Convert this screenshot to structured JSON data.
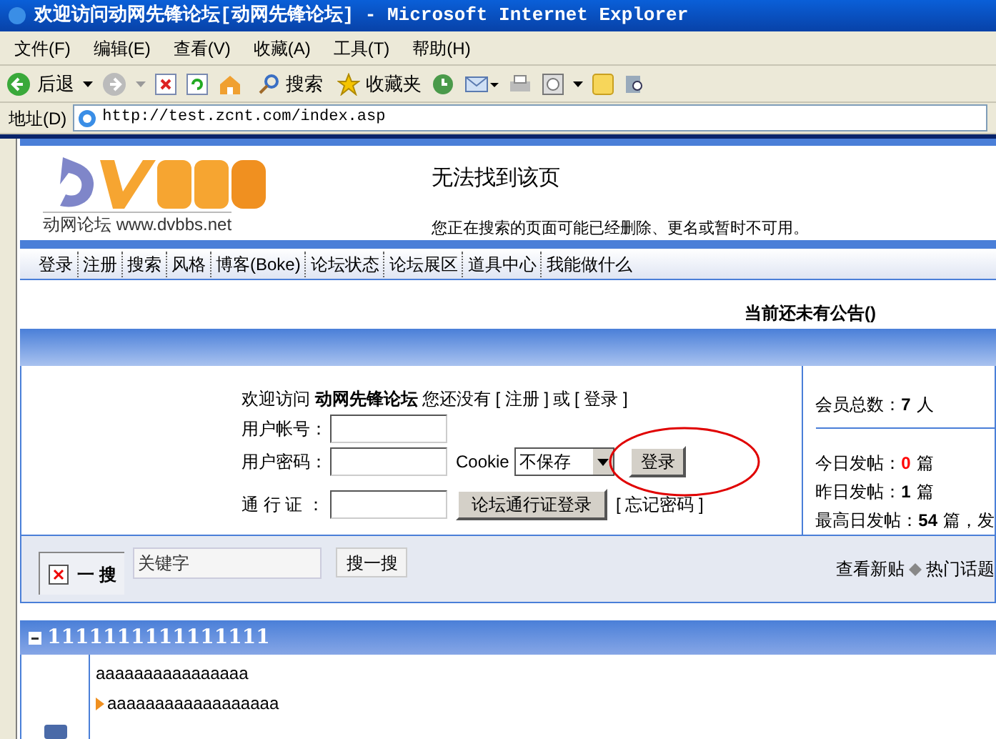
{
  "window": {
    "title": "欢迎访问动网先锋论坛[动网先锋论坛] - Microsoft Internet Explorer"
  },
  "menu": [
    "文件(F)",
    "编辑(E)",
    "查看(V)",
    "收藏(A)",
    "工具(T)",
    "帮助(H)"
  ],
  "toolbar": {
    "back": "后退",
    "search": "搜索",
    "favorites": "收藏夹"
  },
  "address": {
    "label": "地址(D)",
    "value": "http://test.zcnt.com/index.asp"
  },
  "header": {
    "logo_caption": "动网论坛 www.dvbbs.net",
    "error_title": "无法找到该页",
    "error_text": "您正在搜索的页面可能已经删除、更名或暂时不可用。"
  },
  "nav": [
    "登录",
    "注册",
    "搜索",
    "风格",
    "博客(Boke)",
    "论坛状态",
    "论坛展区",
    "道具中心",
    "我能做什么"
  ],
  "announcement": "当前还未有公告()",
  "login": {
    "welcome": "欢迎访问 **动网先锋论坛** 您还没有",
    "register": "[ 注册 ]",
    "or": "或",
    "login_link": "[ 登录 ]",
    "user_label": "用户帐号：",
    "pass_label": "用户密码：",
    "cookie_label": "Cookie",
    "cookie_value": "不保存",
    "login_button": "登录",
    "pass_label2": "通 行 证 ：",
    "pass_button": "论坛通行证登录",
    "forgot": "[ 忘记密码 ]"
  },
  "stats": [
    {
      "label": "会员总数：",
      "value": "7",
      "unit": "人",
      "highlight": false
    },
    {
      "label": "今日发帖：",
      "value": "0",
      "unit": "篇",
      "highlight": true
    },
    {
      "label": "昨日发帖：",
      "value": "1",
      "unit": "篇",
      "highlight": false
    },
    {
      "label": "最高日发帖：",
      "value": "54",
      "unit": "篇，发",
      "highlight": false
    }
  ],
  "search": {
    "label": "一 搜",
    "placeholder": "关键字",
    "button": "搜一搜",
    "links": [
      "查看新贴",
      "热门话题"
    ]
  },
  "forum": {
    "title": "1111111111111111",
    "name": "aaaaaaaaaaaaaaaa",
    "sub": "aaaaaaaaaaaaaaaaaa"
  }
}
